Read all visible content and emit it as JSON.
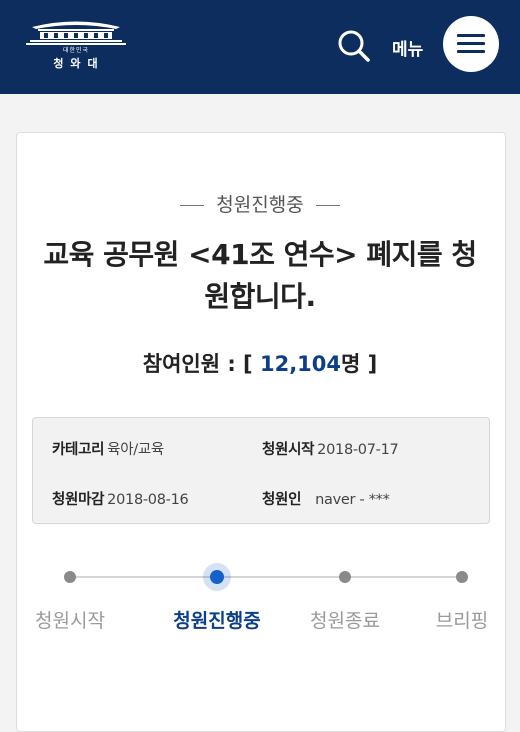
{
  "header": {
    "logo_sub": "대한민국",
    "logo_name": "청와대",
    "menu_label": "메뉴"
  },
  "petition": {
    "status": "청원진행중",
    "title": "교육 공무원 <41조 연수> 폐지를 청원합니다.",
    "count_label": "참여인원 : [",
    "count_value": "12,104",
    "count_suffix": "명 ]",
    "info": {
      "category_label": "카테고리",
      "category_value": "육아/교육",
      "start_label": "청원시작",
      "start_value": "2018-07-17",
      "end_label": "청원마감",
      "end_value": "2018-08-16",
      "author_label": "청원인",
      "author_value": "naver - ***"
    }
  },
  "steps": [
    {
      "label": "청원시작",
      "active": false
    },
    {
      "label": "청원진행중",
      "active": true
    },
    {
      "label": "청원종료",
      "active": false
    },
    {
      "label": "브리핑",
      "active": false
    }
  ],
  "colors": {
    "header_bg": "#0d2d5e",
    "accent": "#0d3e8a",
    "active_dot": "#1661c8"
  }
}
